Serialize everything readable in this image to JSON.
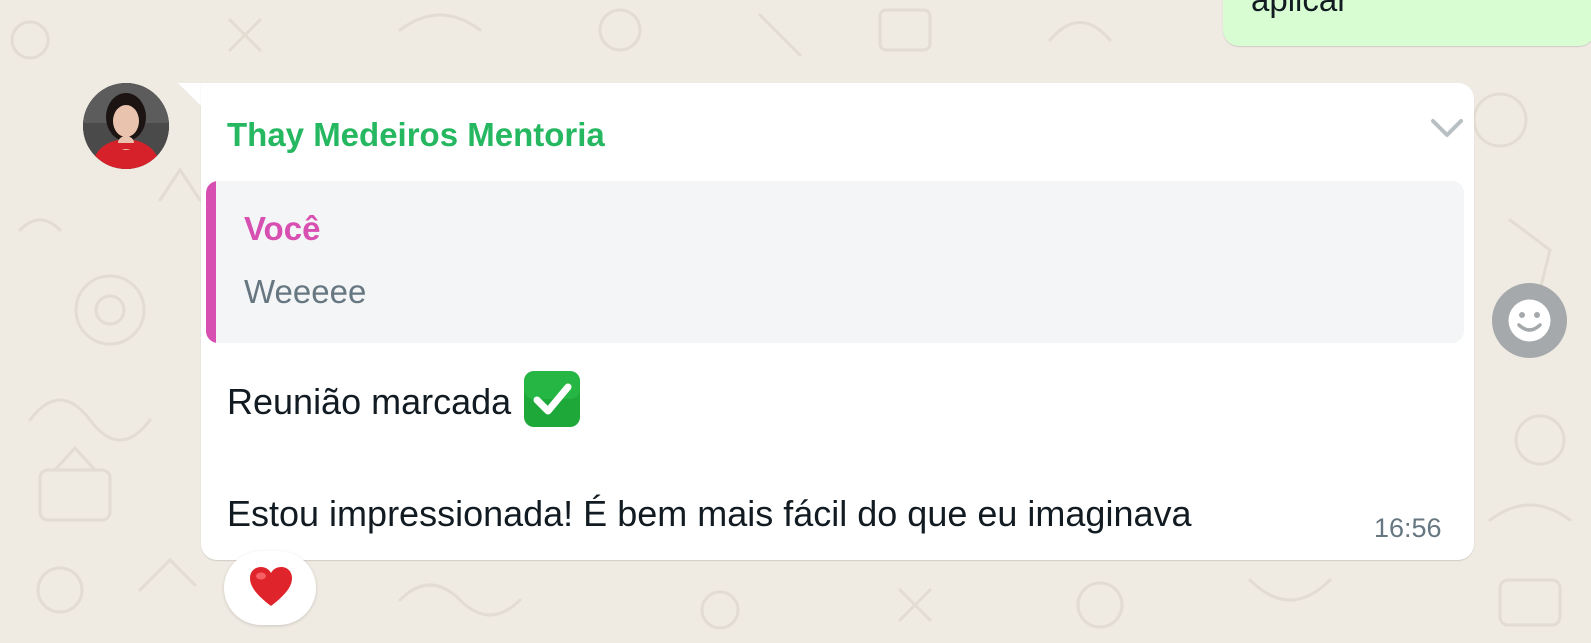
{
  "outgoing_message": {
    "text_fragment": "aplicar"
  },
  "incoming_message": {
    "sender_name": "Thay Medeiros Mentoria",
    "quoted": {
      "author": "Você",
      "text": "Weeeee"
    },
    "line1": "Reunião marcada",
    "line1_emoji": "check-mark-button-icon",
    "line2": "Estou impressionada! É bem mais fácil do que eu imaginava",
    "time": "16:56",
    "reaction": "heart-icon"
  },
  "icons": {
    "menu": "chevron-down-icon",
    "emoji_picker": "smiley-icon"
  },
  "colors": {
    "chat_background": "#efeae2",
    "outgoing_bubble": "#d9fdd3",
    "incoming_bubble": "#ffffff",
    "sender_name": "#25b861",
    "quote_accent": "#d74fb1",
    "meta_text": "#667781",
    "reaction_heart": "#e0242b",
    "check_emoji": "#1fa83a"
  }
}
